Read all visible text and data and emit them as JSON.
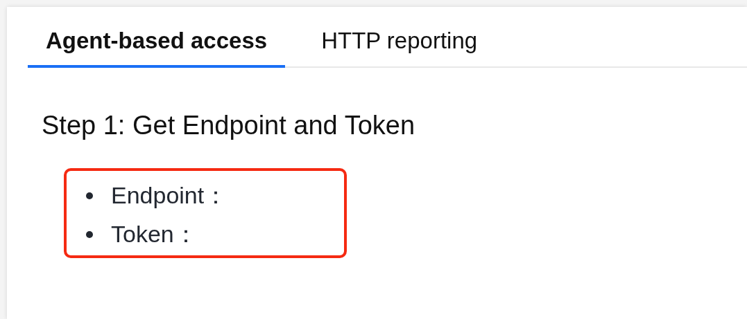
{
  "tabs": [
    {
      "label": "Agent-based access",
      "selected": true
    },
    {
      "label": "HTTP reporting",
      "selected": false
    }
  ],
  "heading": "Step 1: Get Endpoint and Token",
  "items": [
    "Endpoint：",
    "Token："
  ]
}
